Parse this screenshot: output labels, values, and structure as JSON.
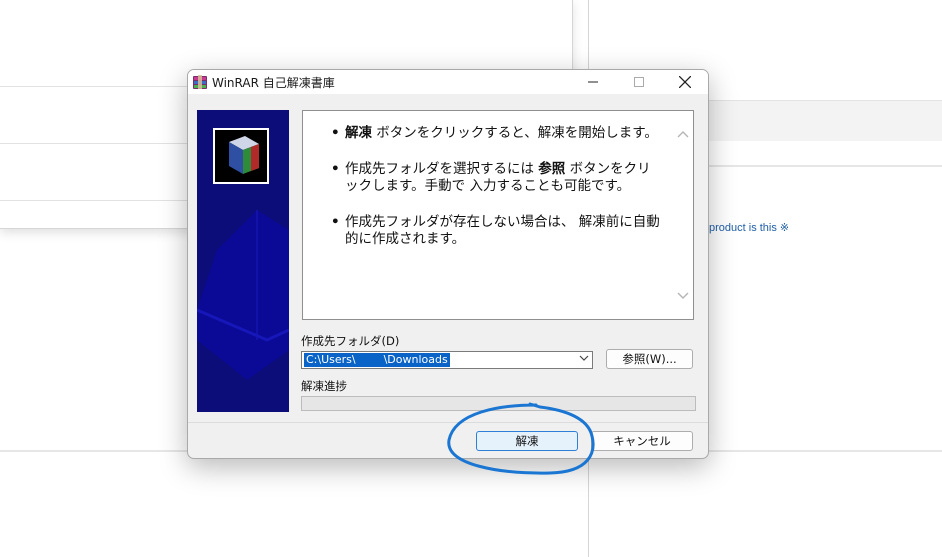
{
  "dialog": {
    "title": "WinRAR 自己解凍書庫",
    "info_items": [
      {
        "bold": "解凍",
        "text": " ボタンをクリックすると、解凍を開始します。"
      },
      {
        "pre": "作成先フォルダを選択するには ",
        "bold": "参照",
        "text": " ボタンをクリックします。手動で 入力することも可能です。"
      },
      {
        "text": "作成先フォルダが存在しない場合は、 解凍前に自動的に作成されます。"
      }
    ],
    "folder_label": "作成先フォルダ(D)",
    "folder_value": "C:\\Users\\        \\Downloads",
    "browse_label": "参照(W)...",
    "progress_label": "解凍進捗",
    "progress": 0,
    "extract_label": "解凍",
    "cancel_label": "キャンセル"
  },
  "background": {
    "right_text": "product is this ※"
  },
  "colors": {
    "banner": "#0d0d7a",
    "selection": "#0a64c8",
    "annotation": "#1a76d2"
  }
}
